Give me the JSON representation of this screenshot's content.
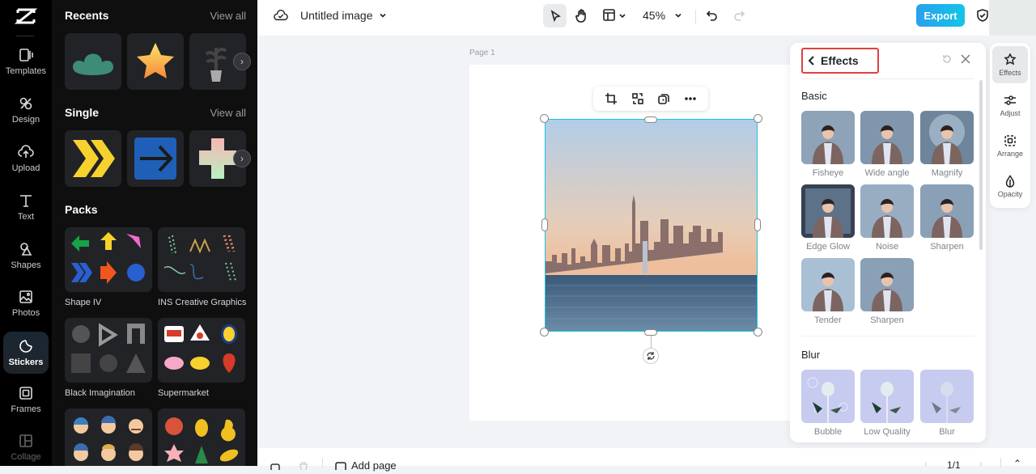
{
  "rail": {
    "items": [
      {
        "label": "Templates",
        "icon": "templates-icon"
      },
      {
        "label": "Design",
        "icon": "design-icon"
      },
      {
        "label": "Upload",
        "icon": "upload-icon"
      },
      {
        "label": "Text",
        "icon": "text-icon"
      },
      {
        "label": "Shapes",
        "icon": "shapes-icon"
      },
      {
        "label": "Photos",
        "icon": "photos-icon"
      },
      {
        "label": "Stickers",
        "icon": "stickers-icon",
        "active": true
      },
      {
        "label": "Frames",
        "icon": "frames-icon"
      },
      {
        "label": "Collage",
        "icon": "collage-icon"
      }
    ]
  },
  "library": {
    "recents": {
      "title": "Recents",
      "view_all": "View all",
      "items": [
        "green cloud sticker",
        "gold star sticker",
        "potted plant sticker"
      ]
    },
    "single": {
      "title": "Single",
      "view_all": "View all",
      "items": [
        "yellow chevrons sticker",
        "blue arrow sticker",
        "pastel flower sticker"
      ]
    },
    "packs": {
      "title": "Packs",
      "items": [
        {
          "label": "Shape IV"
        },
        {
          "label": "INS Creative Graphics"
        },
        {
          "label": "Black Imagination"
        },
        {
          "label": "Supermarket"
        },
        {
          "label": ""
        },
        {
          "label": ""
        }
      ]
    }
  },
  "topbar": {
    "title": "Untitled image",
    "zoom": "45%",
    "export_label": "Export"
  },
  "canvas": {
    "page_label": "Page 1"
  },
  "bottombar": {
    "add_page": "Add page",
    "page_count": "1/1"
  },
  "effects_panel": {
    "title": "Effects",
    "sections": [
      {
        "title": "Basic",
        "items": [
          "Fisheye",
          "Wide angle",
          "Magnify",
          "Edge Glow",
          "Noise",
          "Sharpen",
          "Tender",
          "Sharpen"
        ]
      },
      {
        "title": "Blur",
        "items": [
          "Bubble",
          "Low Quality",
          "Blur"
        ]
      }
    ]
  },
  "side_tabs": [
    {
      "label": "Effects",
      "active": true
    },
    {
      "label": "Adjust"
    },
    {
      "label": "Arrange"
    },
    {
      "label": "Opacity"
    }
  ],
  "colors": {
    "accent": "#16c3e0",
    "export_gradient_start": "#2aa0ee",
    "export_gradient_end": "#12c6e6",
    "highlight_box": "#e24040"
  }
}
